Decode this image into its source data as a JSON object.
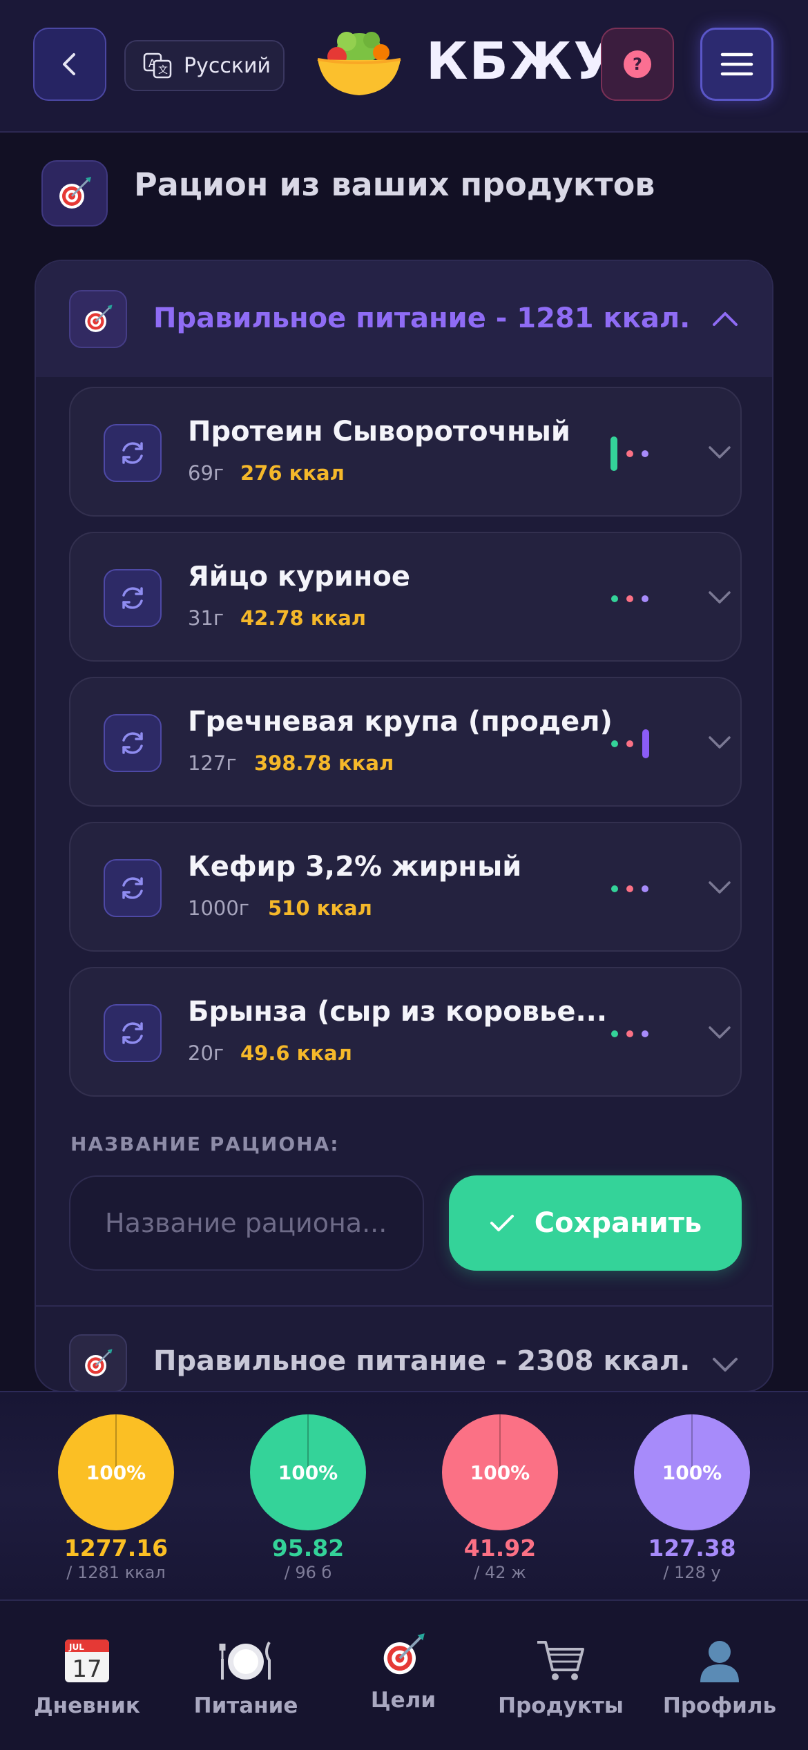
{
  "header": {
    "language": "Русский",
    "logo_text": "КБЖУ"
  },
  "section": {
    "title": "Рацион из ваших продуктов"
  },
  "diet": {
    "title": "Правильное питание - 1281 ккал.",
    "items": [
      {
        "name": "Протеин Сывороточный",
        "grams": "69г",
        "kcal": "276 ккал"
      },
      {
        "name": "Яйцо куриное",
        "grams": "31г",
        "kcal": "42.78 ккал"
      },
      {
        "name": "Гречневая крупа (продел)",
        "grams": "127г",
        "kcal": "398.78 ккал"
      },
      {
        "name": "Кефир 3,2% жирный",
        "grams": "1000г",
        "kcal": "510 ккал"
      },
      {
        "name": "Брынза (сыр из коровье...",
        "grams": "20г",
        "kcal": "49.6 ккал"
      }
    ],
    "name_label": "НАЗВАНИЕ РАЦИОНА:",
    "name_placeholder": "Название рациона...",
    "save_label": "Сохранить"
  },
  "diet2": {
    "title": "Правильное питание - 2308 ккал."
  },
  "summary": [
    {
      "percent": "100%",
      "value": "1277.16",
      "target": "/ 1281 ккал",
      "color": "#fbbf24"
    },
    {
      "percent": "100%",
      "value": "95.82",
      "target": "/ 96 б",
      "color": "#34d399"
    },
    {
      "percent": "100%",
      "value": "41.92",
      "target": "/ 42 ж",
      "color": "#fb7185"
    },
    {
      "percent": "100%",
      "value": "127.38",
      "target": "/ 128 у",
      "color": "#a78bfa"
    }
  ],
  "nav": [
    {
      "label": "Дневник",
      "icon": "calendar-icon",
      "date_month": "JUL",
      "date_day": "17"
    },
    {
      "label": "Питание",
      "icon": "plate-icon"
    },
    {
      "label": "Цели",
      "icon": "target-icon"
    },
    {
      "label": "Продукты",
      "icon": "cart-icon"
    },
    {
      "label": "Профиль",
      "icon": "profile-icon"
    }
  ]
}
